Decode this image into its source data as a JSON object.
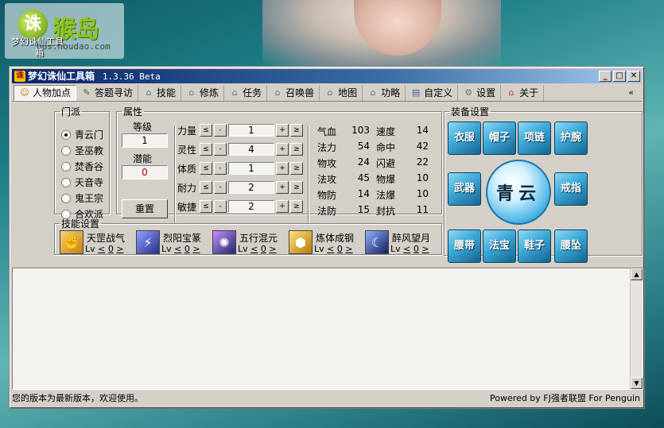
{
  "desktop": {
    "logo_badge": "诛",
    "logo_text": "猴岛",
    "logo_url": "bbs.houdao.com",
    "caption_line1": "梦幻诛仙工具",
    "caption_line2": "箱"
  },
  "window": {
    "title": "梦幻诛仙工具箱",
    "version": "1.3.36 Beta",
    "app_icon": "诛",
    "minimize": "_",
    "maximize": "□",
    "close": "✕"
  },
  "toolbar": {
    "items": [
      {
        "label": "人物加点",
        "icon": "person-icon",
        "active": true
      },
      {
        "label": "答题寻访",
        "icon": "search-icon"
      },
      {
        "label": "技能",
        "icon": "house-icon"
      },
      {
        "label": "修炼",
        "icon": "house-icon"
      },
      {
        "label": "任务",
        "icon": "house-icon"
      },
      {
        "label": "召唤兽",
        "icon": "house-icon"
      },
      {
        "label": "地图",
        "icon": "house-icon"
      },
      {
        "label": "功略",
        "icon": "house-icon"
      },
      {
        "label": "自定义",
        "icon": "doc-icon"
      },
      {
        "label": "设置",
        "icon": "gear-icon"
      },
      {
        "label": "关于",
        "icon": "home-icon"
      }
    ],
    "more": "«"
  },
  "faction": {
    "legend": "门派",
    "options": [
      "青云门",
      "圣巫教",
      "焚香谷",
      "天音寺",
      "鬼王宗",
      "合欢派"
    ],
    "selected": "青云门"
  },
  "attributes": {
    "legend": "属性",
    "level_label": "等级",
    "level_value": "1",
    "potential_label": "潜能",
    "potential_value": "0",
    "reset_label": "重置",
    "btn_minmin": "≤",
    "btn_min": "-",
    "btn_plus": "+",
    "btn_plusplus": "≥",
    "stats": [
      {
        "name": "力量",
        "value": "1"
      },
      {
        "name": "灵性",
        "value": "4"
      },
      {
        "name": "体质",
        "value": "1"
      },
      {
        "name": "耐力",
        "value": "2"
      },
      {
        "name": "敏捷",
        "value": "2"
      }
    ],
    "derived_left": [
      {
        "name": "气血",
        "value": "103"
      },
      {
        "name": "法力",
        "value": "54"
      },
      {
        "name": "物攻",
        "value": "24"
      },
      {
        "name": "法攻",
        "value": "45"
      },
      {
        "name": "物防",
        "value": "14"
      },
      {
        "name": "法防",
        "value": "15"
      }
    ],
    "derived_right": [
      {
        "name": "速度",
        "value": "14"
      },
      {
        "name": "命中",
        "value": "42"
      },
      {
        "name": "闪避",
        "value": "22"
      },
      {
        "name": "物爆",
        "value": "10"
      },
      {
        "name": "法爆",
        "value": "10"
      },
      {
        "name": "封抗",
        "value": "11"
      }
    ]
  },
  "equipment": {
    "legend": "装备设置",
    "slots": {
      "clothes": "衣服",
      "hat": "帽子",
      "necklace": "项链",
      "bracer": "护腕",
      "weapon": "武器",
      "ring": "戒指",
      "belt": "腰带",
      "treasure": "法宝",
      "shoes": "鞋子",
      "pendant": "腰坠"
    },
    "orb_text": "青云"
  },
  "skills": {
    "legend": "技能设置",
    "lv_prefix": "Lv",
    "lv_left": "<",
    "lv_right": ">",
    "items": [
      {
        "name": "天罡战气",
        "level": "0",
        "color": "#d9a23a"
      },
      {
        "name": "烈阳宝篆",
        "level": "0",
        "color": "#4a55c8"
      },
      {
        "name": "五行混元",
        "level": "0",
        "color": "#3a3f9a"
      },
      {
        "name": "炼体成钢",
        "level": "0",
        "color": "#d8a41a"
      },
      {
        "name": "醉风望月",
        "level": "0",
        "color": "#2a3a8a"
      }
    ]
  },
  "status": {
    "left": "您的版本为最新版本，欢迎使用。",
    "right": "Powered by FJ强者联盟 For Penguin"
  }
}
